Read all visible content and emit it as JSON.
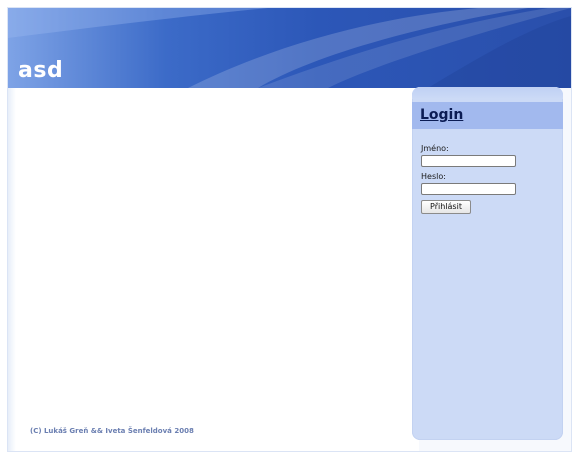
{
  "site": {
    "title": "asd"
  },
  "sidebar": {
    "login_heading": "Login",
    "username_label": "Jméno:",
    "username_value": "",
    "password_label": "Heslo:",
    "password_value": "",
    "submit_label": "Přihlásit"
  },
  "footer": {
    "copyright": "(C) Lukáš Greň && Iveta Šenfeldová 2008"
  },
  "colors": {
    "header_dark": "#2a4fab",
    "header_light": "#7ea3e6",
    "sidebar_bg": "#ccdaf6",
    "login_band": "#a2b9ee"
  }
}
